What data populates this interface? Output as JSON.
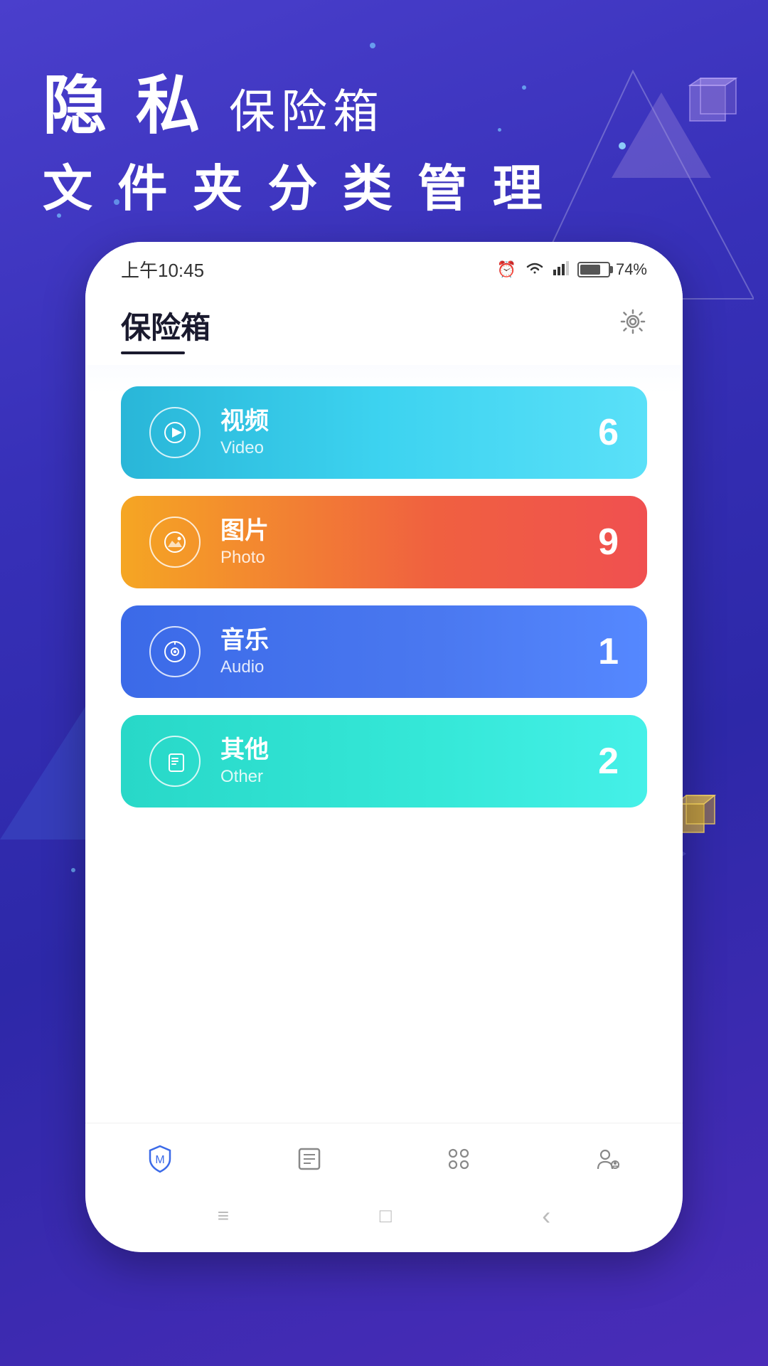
{
  "app": {
    "name": "隐私保险箱",
    "tagline1_part1": "隐 私",
    "tagline1_part2": "保险箱",
    "tagline2": "文 件 夹 分 类 管 理"
  },
  "status_bar": {
    "time": "上午10:45",
    "battery_percent": "74%"
  },
  "header": {
    "title": "保险箱",
    "settings_label": "⚙"
  },
  "categories": [
    {
      "id": "video",
      "name_cn": "视频",
      "name_en": "Video",
      "count": "6"
    },
    {
      "id": "photo",
      "name_cn": "图片",
      "name_en": "Photo",
      "count": "9"
    },
    {
      "id": "audio",
      "name_cn": "音乐",
      "name_en": "Audio",
      "count": "1"
    },
    {
      "id": "other",
      "name_cn": "其他",
      "name_en": "Other",
      "count": "2"
    }
  ],
  "bottom_nav": [
    {
      "id": "safe",
      "active": true
    },
    {
      "id": "list",
      "active": false
    },
    {
      "id": "apps",
      "active": false
    },
    {
      "id": "user",
      "active": false
    }
  ],
  "sys_nav": {
    "menu": "≡",
    "home": "□",
    "back": "‹"
  }
}
